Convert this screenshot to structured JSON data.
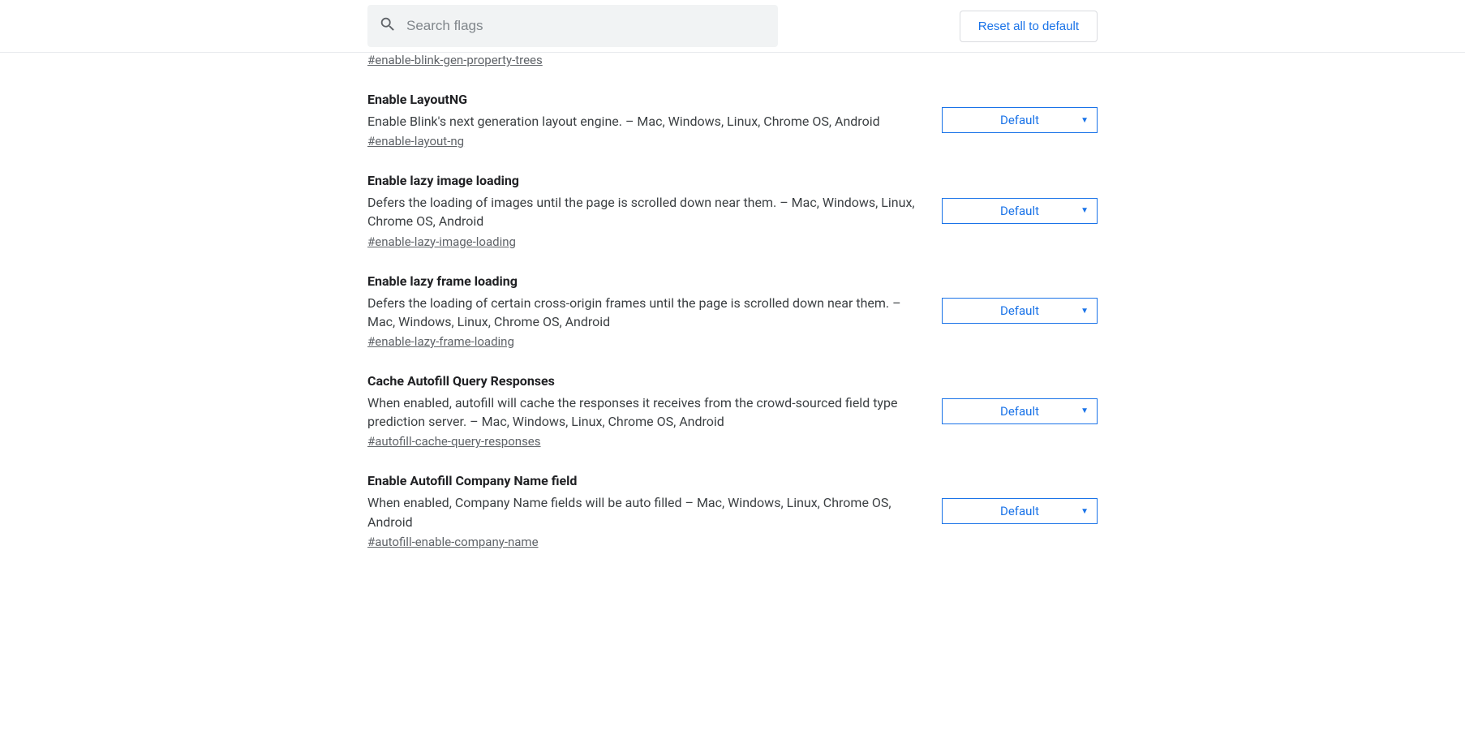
{
  "header": {
    "search_placeholder": "Search flags",
    "reset_label": "Reset all to default"
  },
  "flags": [
    {
      "title": "",
      "description": "",
      "hash": "#enable-blink-gen-property-trees",
      "select": "",
      "partial": true
    },
    {
      "title": "Enable LayoutNG",
      "description": "Enable Blink's next generation layout engine. – Mac, Windows, Linux, Chrome OS, Android",
      "hash": "#enable-layout-ng",
      "select": "Default"
    },
    {
      "title": "Enable lazy image loading",
      "description": "Defers the loading of images until the page is scrolled down near them. – Mac, Windows, Linux, Chrome OS, Android",
      "hash": "#enable-lazy-image-loading",
      "select": "Default"
    },
    {
      "title": "Enable lazy frame loading",
      "description": "Defers the loading of certain cross-origin frames until the page is scrolled down near them. – Mac, Windows, Linux, Chrome OS, Android",
      "hash": "#enable-lazy-frame-loading",
      "select": "Default"
    },
    {
      "title": "Cache Autofill Query Responses",
      "description": "When enabled, autofill will cache the responses it receives from the crowd-sourced field type prediction server. – Mac, Windows, Linux, Chrome OS, Android",
      "hash": "#autofill-cache-query-responses",
      "select": "Default"
    },
    {
      "title": "Enable Autofill Company Name field",
      "description": "When enabled, Company Name fields will be auto filled – Mac, Windows, Linux, Chrome OS, Android",
      "hash": "#autofill-enable-company-name",
      "select": "Default"
    }
  ]
}
